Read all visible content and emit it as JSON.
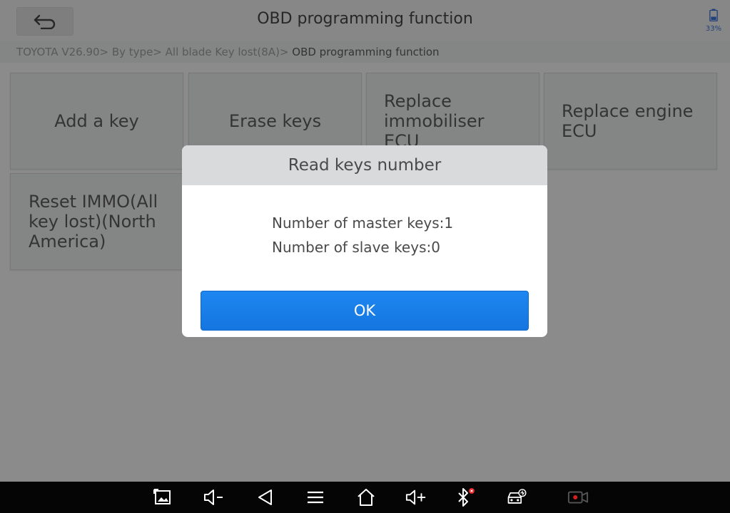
{
  "header": {
    "title": "OBD programming function",
    "battery_percent": "33%"
  },
  "breadcrumb": {
    "path": "TOYOTA V26.90> By type> All blade Key lost(8A)> ",
    "current": "OBD programming function"
  },
  "tiles": [
    {
      "label": "Add a key"
    },
    {
      "label": "Erase keys"
    },
    {
      "label": "Replace immobiliser ECU"
    },
    {
      "label": "Replace engine ECU"
    },
    {
      "label": "Reset IMMO(All key lost)(North America)"
    }
  ],
  "dialog": {
    "title": "Read keys number",
    "line1": "Number of master keys:1",
    "line2": "Number of slave keys:0",
    "ok_label": "OK"
  },
  "navbar": {
    "icons": [
      "screenshot-icon",
      "volume-down-icon",
      "back-icon",
      "menu-icon",
      "home-icon",
      "volume-up-icon",
      "bluetooth-icon",
      "car-diagnostic-icon",
      "screen-record-icon"
    ]
  },
  "colors": {
    "accent": "#1a7fea",
    "background": "#efefef",
    "navbar": "#050505"
  }
}
